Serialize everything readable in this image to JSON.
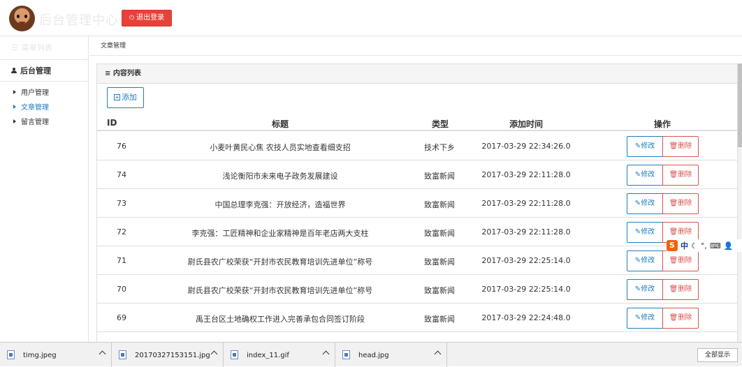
{
  "header": {
    "site_title": "后台管理中心",
    "logout_label": "退出登录",
    "logout_icon": "power-icon"
  },
  "sidebar": {
    "menu_title": "菜单列表",
    "group_label": "后台管理",
    "items": [
      {
        "label": "用户管理",
        "active": false
      },
      {
        "label": "文章管理",
        "active": true
      },
      {
        "label": "留言管理",
        "active": false
      }
    ]
  },
  "breadcrumb": "文章管理",
  "panel": {
    "title": "内容列表",
    "add_label": "添加",
    "edit_label": "修改",
    "delete_label": "删除",
    "columns": {
      "id": "ID",
      "title": "标题",
      "type": "类型",
      "time": "添加时间",
      "action": "操作"
    },
    "rows": [
      {
        "id": "76",
        "title": "小麦叶黄民心焦 农技人员实地查看细支招",
        "type": "技术下乡",
        "time": "2017-03-29 22:34:26.0"
      },
      {
        "id": "74",
        "title": "浅论衡阳市未来电子政务发展建设",
        "type": "致富新闻",
        "time": "2017-03-29 22:11:28.0"
      },
      {
        "id": "73",
        "title": "中国总理李克强：开放经济，造福世界",
        "type": "致富新闻",
        "time": "2017-03-29 22:11:28.0"
      },
      {
        "id": "72",
        "title": "李克强：工匠精神和企业家精神是百年老店两大支柱",
        "type": "致富新闻",
        "time": "2017-03-29 22:11:28.0"
      },
      {
        "id": "71",
        "title": "尉氏县农广校荣获“开封市农民教育培训先进单位”称号",
        "type": "致富新闻",
        "time": "2017-03-29 22:25:14.0"
      },
      {
        "id": "70",
        "title": "尉氏县农广校荣获“开封市农民教育培训先进单位”称号",
        "type": "致富新闻",
        "time": "2017-03-29 22:25:14.0"
      },
      {
        "id": "69",
        "title": "禹王台区土地确权工作进入完善承包合同签订阶段",
        "type": "致富新闻",
        "time": "2017-03-29 22:24:48.0"
      }
    ]
  },
  "ime": {
    "logo": "S",
    "mode": "中"
  },
  "downloads": {
    "files": [
      "timg.jpeg",
      "20170327153151.jpg",
      "index_11.gif",
      "head.jpg"
    ],
    "show_all_label": "全部显示"
  },
  "colors": {
    "accent": "#1e7fbd",
    "danger": "#d9534f",
    "logout": "#e8413a"
  }
}
